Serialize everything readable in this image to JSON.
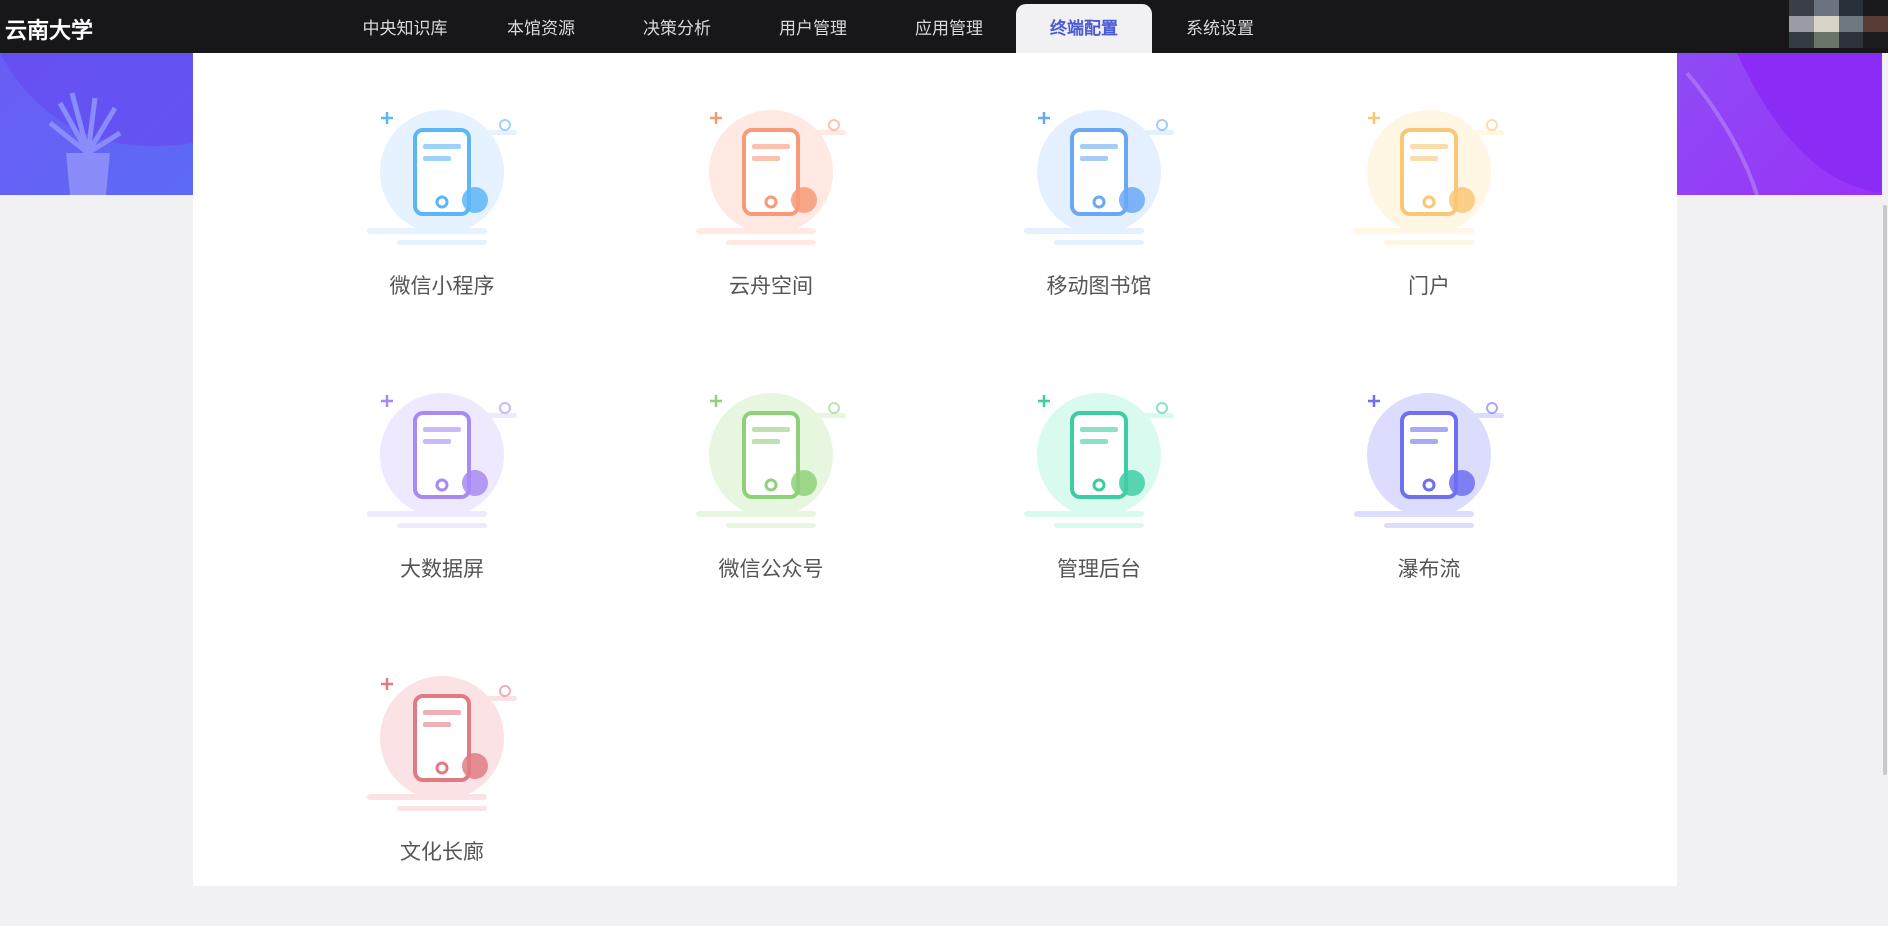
{
  "header": {
    "logo": "云南大学",
    "nav": [
      {
        "label": "中央知识库",
        "active": false
      },
      {
        "label": "本馆资源",
        "active": false
      },
      {
        "label": "决策分析",
        "active": false
      },
      {
        "label": "用户管理",
        "active": false
      },
      {
        "label": "应用管理",
        "active": false
      },
      {
        "label": "终端配置",
        "active": true
      },
      {
        "label": "系统设置",
        "active": false
      }
    ]
  },
  "tiles": [
    {
      "label": "微信小程序",
      "icon": "mini-program-icon",
      "color": "#5bb6f7",
      "bg": "#e6f2ff"
    },
    {
      "label": "云舟空间",
      "icon": "cloud-space-icon",
      "color": "#f79a78",
      "bg": "#ffe9e2"
    },
    {
      "label": "移动图书馆",
      "icon": "mobile-library-icon",
      "color": "#6aa8f5",
      "bg": "#e4efff"
    },
    {
      "label": "门户",
      "icon": "portal-icon",
      "color": "#f9c776",
      "bg": "#fff6e3"
    },
    {
      "label": "大数据屏",
      "icon": "big-data-screen-icon",
      "color": "#a78bf5",
      "bg": "#efe9ff"
    },
    {
      "label": "微信公众号",
      "icon": "wechat-official-icon",
      "color": "#8fd07a",
      "bg": "#e7f7df"
    },
    {
      "label": "管理后台",
      "icon": "admin-backend-icon",
      "color": "#3fcca5",
      "bg": "#d9fbef"
    },
    {
      "label": "瀑布流",
      "icon": "waterfall-icon",
      "color": "#6f6ff2",
      "bg": "#dcdcff"
    },
    {
      "label": "文化长廊",
      "icon": "culture-gallery-icon",
      "color": "#e07b84",
      "bg": "#fbe3e5"
    }
  ]
}
